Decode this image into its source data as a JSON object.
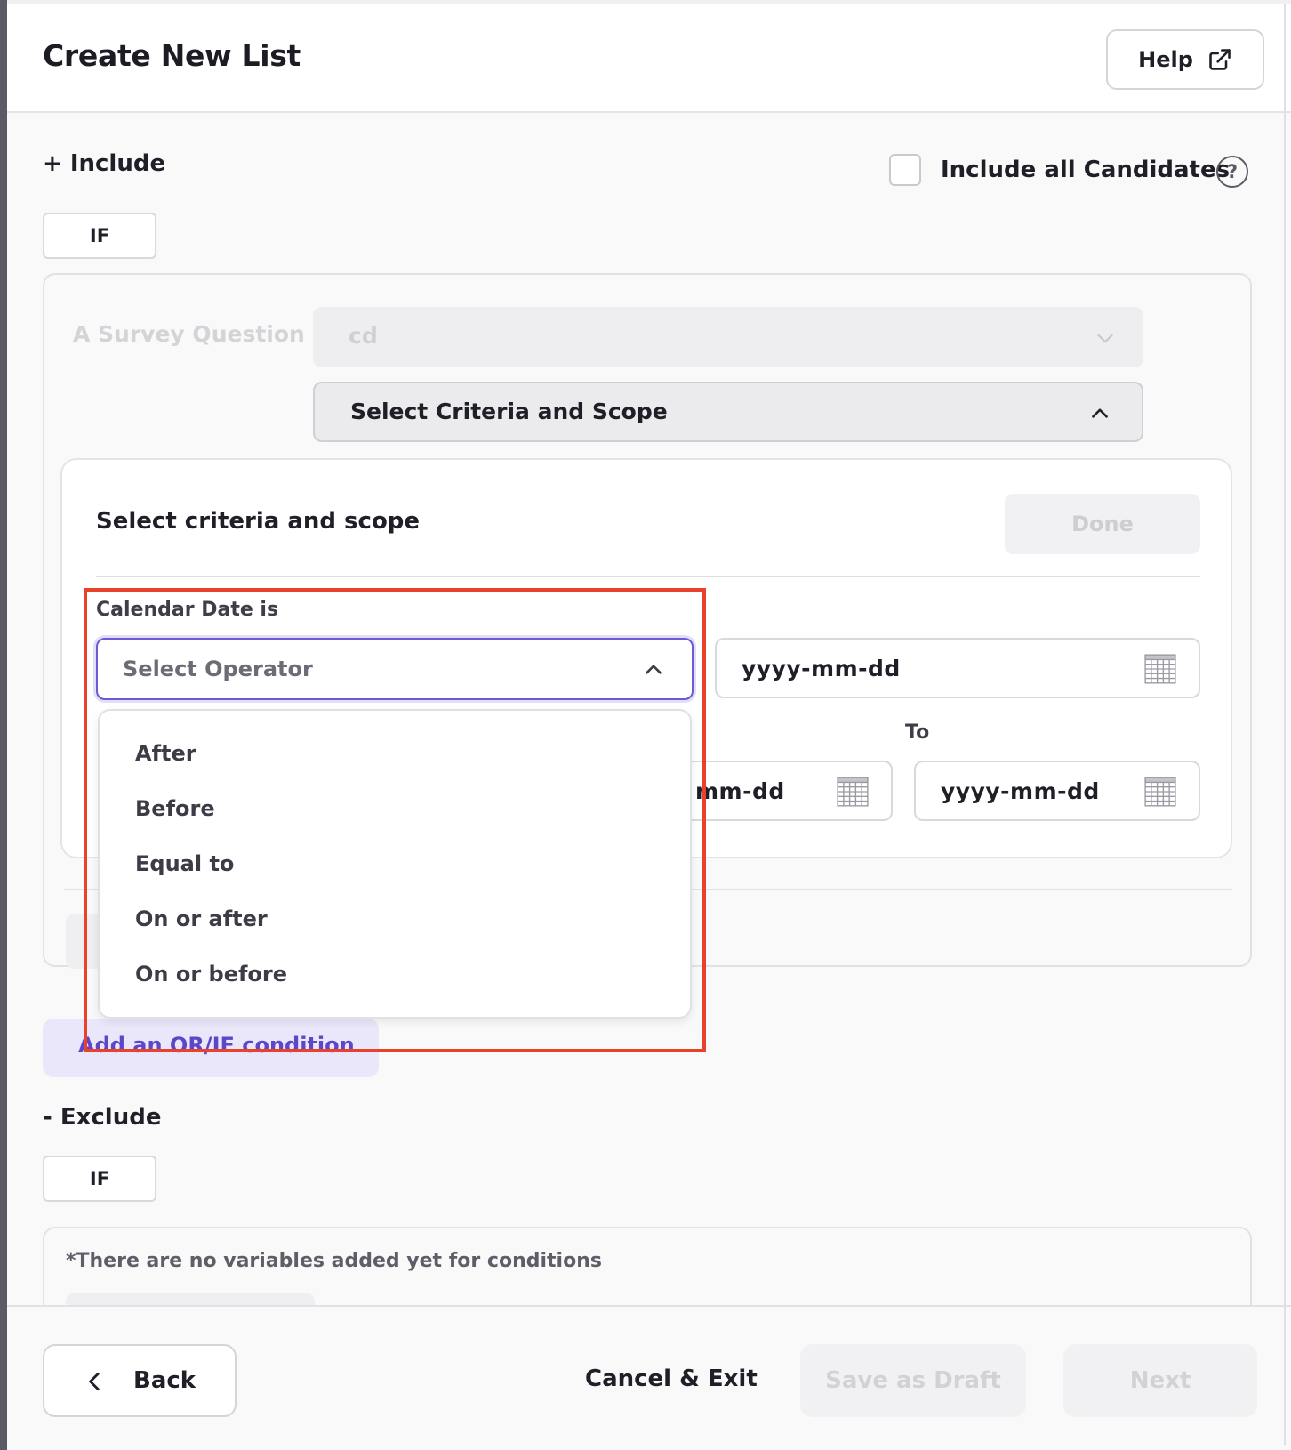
{
  "header": {
    "title": "Create New List",
    "help_label": "Help"
  },
  "include": {
    "label": "+ Include",
    "include_all_label": "Include all Candidates",
    "if_label": "IF",
    "survey_question_label": "A Survey Question",
    "survey_question_value": "cd",
    "criteria_select_label": "Select Criteria and Scope",
    "add_condition_label": "Add an OR/IF condition"
  },
  "criteria_card": {
    "title": "Select criteria and scope",
    "done_label": "Done",
    "calendar_label": "Calendar Date is",
    "operator_placeholder": "Select Operator",
    "date_placeholder": "yyyy-mm-dd",
    "from_partial_text": "mm-dd",
    "to_label": "To",
    "to_date_placeholder": "yyyy-mm-dd"
  },
  "operator_options": [
    "After",
    "Before",
    "Equal to",
    "On or after",
    "On or before"
  ],
  "exclude": {
    "label": "- Exclude",
    "if_label": "IF",
    "no_variables_text": "*There are no variables added yet for conditions"
  },
  "footer": {
    "back_label": "Back",
    "cancel_label": "Cancel & Exit",
    "save_draft_label": "Save as Draft",
    "next_label": "Next"
  },
  "colors": {
    "accent": "#6c5bd4",
    "highlight": "#e8412c",
    "disabled_text": "#d2d2d6"
  },
  "icons": {
    "help": "external-link-icon",
    "question": "question-circle-icon",
    "chevron_up": "chevron-up-icon",
    "chevron_down": "chevron-down-icon",
    "calendar": "calendar-icon",
    "back": "chevron-left-icon"
  }
}
